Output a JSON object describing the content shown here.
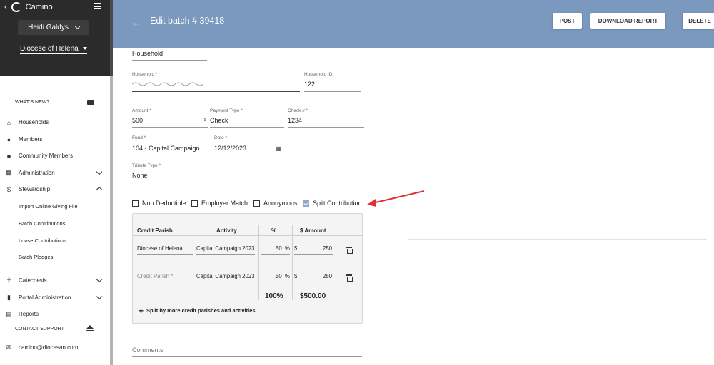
{
  "app": {
    "name": "Camino"
  },
  "sidebar": {
    "user": "Heidi Galdys",
    "diocese": "Diocese of Helena",
    "whats_new": "WHAT'S NEW?",
    "items": [
      {
        "label": "Households",
        "icon": "home-icon"
      },
      {
        "label": "Members",
        "icon": "people-icon"
      },
      {
        "label": "Community Members",
        "icon": "building-icon"
      },
      {
        "label": "Administration",
        "icon": "grid-icon"
      },
      {
        "label": "Stewardship",
        "icon": "dollar-icon"
      },
      {
        "label": "Catechesis",
        "icon": "cross-icon"
      },
      {
        "label": "Portal Administration",
        "icon": "portal-icon"
      },
      {
        "label": "Reports",
        "icon": "report-icon"
      }
    ],
    "stewardship_sub": [
      "Import Online Giving File",
      "Batch Contributions",
      "Loose Contributions",
      "Batch Pledges"
    ],
    "contact_support": "CONTACT SUPPORT",
    "email": "camino@diocesan.com"
  },
  "header": {
    "title": "Edit batch # 39418",
    "buttons": {
      "post": "POST",
      "download": "DOWNLOAD REPORT",
      "delete": "DELETE"
    }
  },
  "form": {
    "household_type": "Household",
    "household_label": "Household *",
    "household_id_label": "Household ID",
    "household_id": "122",
    "amount_label": "Amount *",
    "amount": "500",
    "payment_type_label": "Payment Type *",
    "payment_type": "Check",
    "check_label": "Check # *",
    "check": "1234",
    "fund_label": "Fund *",
    "fund": "104 - Capital Campaign",
    "date_label": "Date *",
    "date": "12/12/2023",
    "tribute_label": "Tribute Type *",
    "tribute": "None",
    "checkboxes": [
      {
        "label": "Non Deductible",
        "checked": false
      },
      {
        "label": "Employer Match",
        "checked": false
      },
      {
        "label": "Anonymous",
        "checked": false
      },
      {
        "label": "Split Contribution",
        "checked": true
      }
    ],
    "comments_placeholder": "Comments"
  },
  "split": {
    "headers": {
      "parish": "Credit Parish",
      "activity": "Activity",
      "pct": "%",
      "amount": "$ Amount"
    },
    "rows": [
      {
        "parish": "Diocese of Helena",
        "activity": "Capital Campaign 2023",
        "pct": "50",
        "amount": "250"
      },
      {
        "parish": "Credit Parish *",
        "activity": "Capital Campaign 2023",
        "pct": "50",
        "amount": "250"
      }
    ],
    "pct_unit": "%",
    "currency": "$",
    "total_pct": "100%",
    "total_amount": "$500.00",
    "add_label": "Split by more credit parishes and activities"
  },
  "colors": {
    "header": "#7b98bf",
    "sidebar_dark": "#2b2b2b",
    "annotation": "#e03131"
  }
}
